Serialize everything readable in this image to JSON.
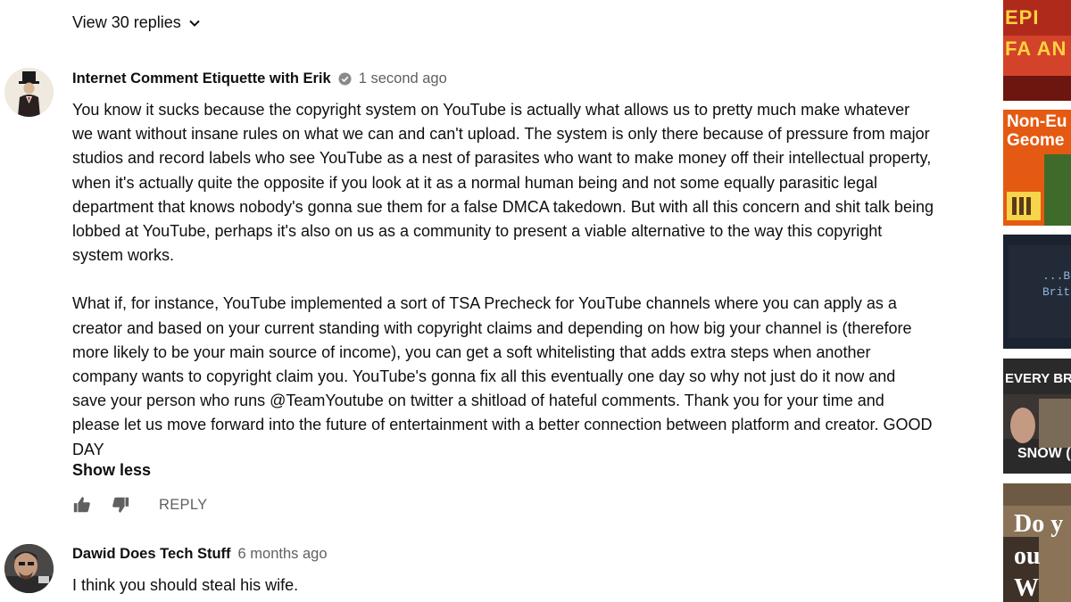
{
  "replies_toggle": {
    "label": "View 30 replies"
  },
  "comments": [
    {
      "author": "Internet Comment Etiquette with Erik",
      "time": "1 second ago",
      "paragraphs": [
        "You know it sucks because the copyright system on YouTube is actually what allows us to pretty much make whatever we want without insane rules on what we can and can't upload. The system is only there because of pressure from major studios and record labels who see YouTube as a nest of parasites who want to make money off their intellectual property, when it's actually quite the opposite if you look at it as a normal human being and not some equally parasitic legal department that knows nobody's gonna sue them for a false DMCA takedown. But with all this concern and shit talk being lobbed at YouTube, perhaps it's also on us as a community to present a viable alternative to the way this copyright system works.",
        "What if, for instance, YouTube implemented a sort of TSA Precheck for YouTube channels where you can apply as a creator and based on your current standing with copyright claims and depending on how big your channel is (therefore more likely to be your main source of income), you can get a soft whitelisting that adds extra steps when another company wants to copyright claim you. YouTube's gonna fix all this eventually one day so why not just do it now and save your person who runs @TeamYoutube on twitter a shitload of hateful comments. Thank you for your time and please let us move forward into the future of entertainment with a better connection between platform and creator. GOOD DAY"
      ],
      "show_less": "Show less",
      "reply_label": "REPLY"
    },
    {
      "author": "Dawid Does Tech Stuff",
      "time": "6 months ago",
      "text": "I think you should steal his wife."
    }
  ],
  "sidebar_thumbs": [
    {
      "text": "EPI FA AN"
    },
    {
      "text": "Non-Eu Geome"
    },
    {
      "text": "...B Brit"
    },
    {
      "text": "EVERY BREAT",
      "text2": "SNOW (H"
    },
    {
      "text": "Do y ou W"
    }
  ],
  "colors": {
    "text": "#0f0f0f",
    "secondary": "#606060",
    "background": "#ffffff"
  }
}
